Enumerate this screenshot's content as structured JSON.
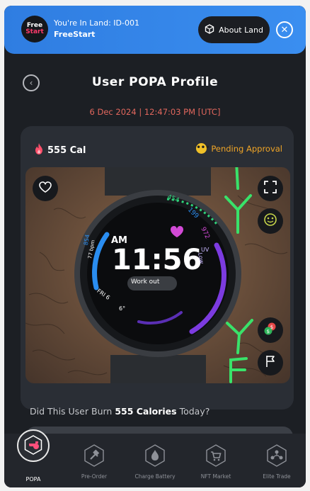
{
  "banner": {
    "logo": {
      "line1": "Free",
      "line2": "Start"
    },
    "land_line": "You're In Land: ID-001",
    "land_name": "FreeStart",
    "about_label": "About Land"
  },
  "header": {
    "title": "User POPA Profile",
    "timestamp": "6 Dec 2024 | 12:47:03 PM [UTC]"
  },
  "card": {
    "calories": "555 Cal",
    "status": "Pending Approval",
    "watch": {
      "am": "AM",
      "time": "11:56",
      "workout": "Work out",
      "date": "FRI 6",
      "steps_top": "454",
      "hr": "199",
      "cal_ring": "972",
      "left_top": "854",
      "left_mid": "77 bpm",
      "uv": "UV",
      "low": "Low",
      "temp": "6°"
    },
    "annotations": [
      "1",
      "Y",
      "Y",
      "E"
    ]
  },
  "question": {
    "prefix": "Did This User Burn ",
    "value": "555 Calories",
    "suffix": " Today?"
  },
  "nav": {
    "items": [
      {
        "label": "POPA"
      },
      {
        "label": "Pre-Order"
      },
      {
        "label": "Charge Battery"
      },
      {
        "label": "NFT Market"
      },
      {
        "label": "Elite Trade"
      }
    ]
  },
  "colors": {
    "accent_blue": "#2f7de1",
    "timestamp_red": "#e2675d",
    "pending_orange": "#f0a527",
    "annotation_green": "#39e26a",
    "popa_pink": "#ff4f7b"
  }
}
